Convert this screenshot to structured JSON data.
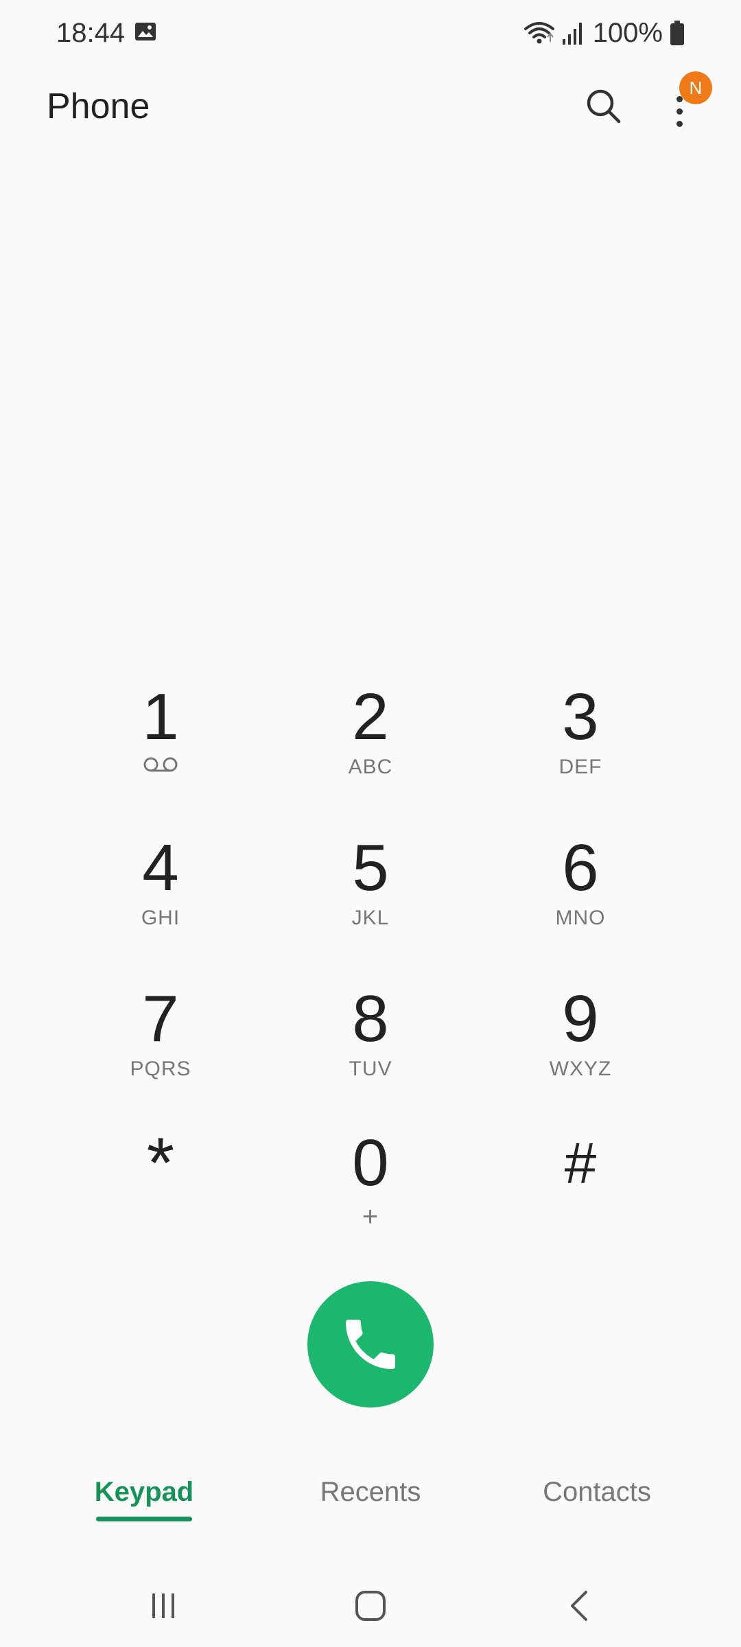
{
  "status_bar": {
    "time": "18:44",
    "battery_text": "100%",
    "icons": [
      "gallery-icon",
      "wifi-icon",
      "signal-icon",
      "battery-icon"
    ]
  },
  "app_bar": {
    "title": "Phone",
    "search_icon": "search-icon",
    "more_icon": "more-vertical-icon",
    "badge": "N",
    "badge_color": "#f07a18"
  },
  "keypad": {
    "keys": [
      {
        "digit": "1",
        "letters": "",
        "sub_icon": "voicemail-icon"
      },
      {
        "digit": "2",
        "letters": "ABC"
      },
      {
        "digit": "3",
        "letters": "DEF"
      },
      {
        "digit": "4",
        "letters": "GHI"
      },
      {
        "digit": "5",
        "letters": "JKL"
      },
      {
        "digit": "6",
        "letters": "MNO"
      },
      {
        "digit": "7",
        "letters": "PQRS"
      },
      {
        "digit": "8",
        "letters": "TUV"
      },
      {
        "digit": "9",
        "letters": "WXYZ"
      },
      {
        "digit": "*",
        "letters": ""
      },
      {
        "digit": "0",
        "letters": "+"
      },
      {
        "digit": "#",
        "letters": ""
      }
    ]
  },
  "call_button": {
    "icon": "phone-call-icon",
    "color": "#1ab76c"
  },
  "tabs": [
    {
      "label": "Keypad",
      "active": true
    },
    {
      "label": "Recents",
      "active": false
    },
    {
      "label": "Contacts",
      "active": false
    }
  ],
  "accent_color": "#17935a",
  "nav_bar": {
    "icons": [
      "recent-apps-icon",
      "home-icon",
      "back-icon"
    ]
  }
}
